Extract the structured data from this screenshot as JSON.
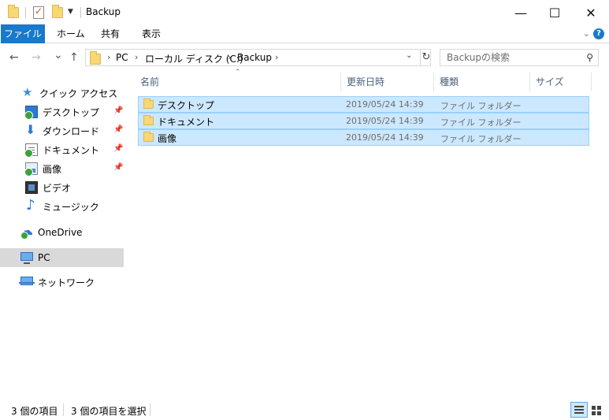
{
  "window": {
    "title": "Backup",
    "controls": {
      "minimize": "—",
      "maximize": "☐",
      "close": "✕"
    }
  },
  "ribbon": {
    "tabs": [
      "ファイル",
      "ホーム",
      "共有",
      "表示"
    ],
    "expand_icon": "chevron-down-icon",
    "help_label": "?"
  },
  "navigation": {
    "back": "←",
    "forward": "→",
    "recent": "⌄",
    "up": "↑",
    "breadcrumb": [
      "PC",
      "ローカル ディスク (C:)",
      "Backup"
    ],
    "search_placeholder": "Backupの検索"
  },
  "nav_pane": {
    "items": [
      {
        "label": "クイック アクセス",
        "icon": "star-icon",
        "pinned": false
      },
      {
        "label": "デスクトップ",
        "icon": "desktop-icon",
        "pinned": true
      },
      {
        "label": "ダウンロード",
        "icon": "download-icon",
        "pinned": true
      },
      {
        "label": "ドキュメント",
        "icon": "documents-icon",
        "pinned": true
      },
      {
        "label": "画像",
        "icon": "pictures-icon",
        "pinned": true
      },
      {
        "label": "ビデオ",
        "icon": "videos-icon",
        "pinned": false
      },
      {
        "label": "ミュージック",
        "icon": "music-icon",
        "pinned": false
      },
      {
        "label": "OneDrive",
        "icon": "onedrive-icon",
        "pinned": false
      },
      {
        "label": "PC",
        "icon": "pc-icon",
        "pinned": false,
        "selected": true
      },
      {
        "label": "ネットワーク",
        "icon": "network-icon",
        "pinned": false
      }
    ]
  },
  "file_list": {
    "columns": [
      "名前",
      "更新日時",
      "種類",
      "サイズ"
    ],
    "rows": [
      {
        "name": "デスクトップ",
        "modified": "2019/05/24 14:39",
        "type": "ファイル フォルダー",
        "size": ""
      },
      {
        "name": "ドキュメント",
        "modified": "2019/05/24 14:39",
        "type": "ファイル フォルダー",
        "size": ""
      },
      {
        "name": "画像",
        "modified": "2019/05/24 14:39",
        "type": "ファイル フォルダー",
        "size": ""
      }
    ]
  },
  "status_bar": {
    "item_count": "3 個の項目",
    "selected_count": "3 個の項目を選択"
  },
  "colors": {
    "accent": "#1979ca",
    "selection_bg": "#cce8ff",
    "selection_border": "#99d1ff",
    "nav_selected_bg": "#d9d9d9"
  }
}
